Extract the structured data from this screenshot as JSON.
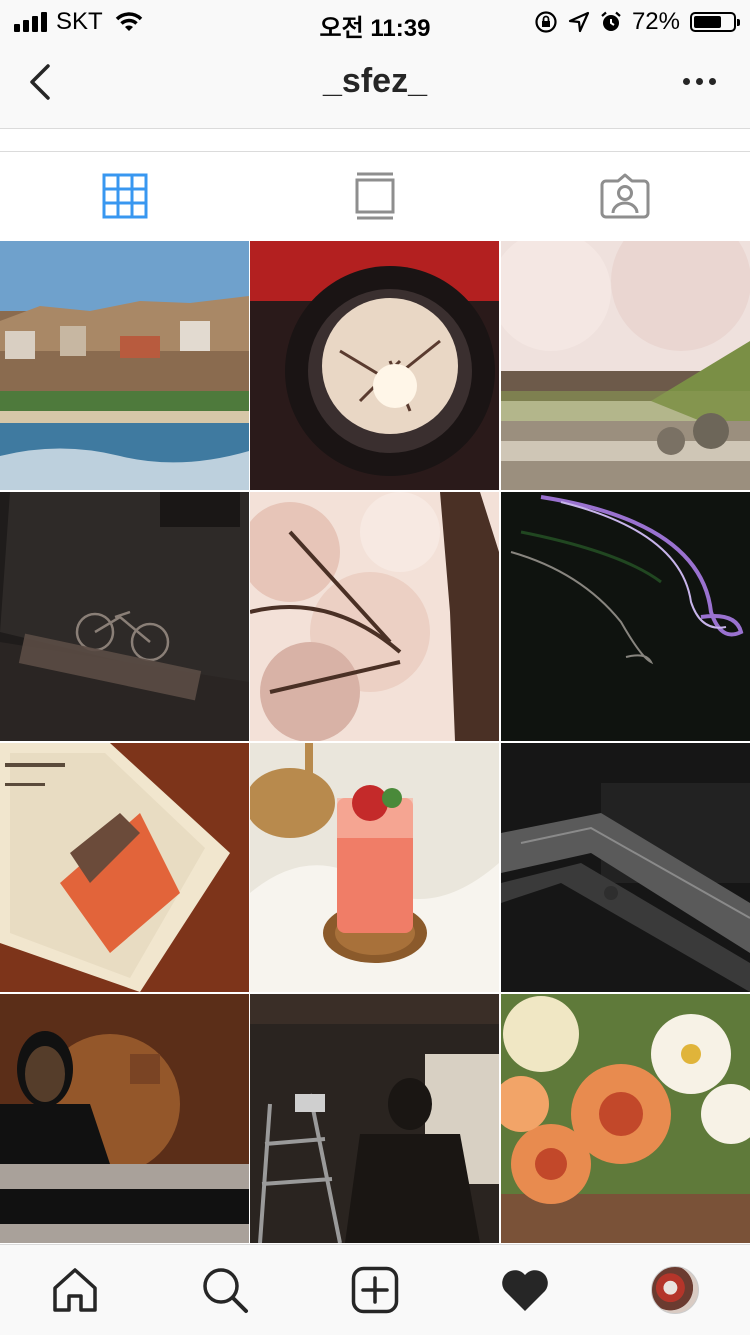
{
  "status_bar": {
    "carrier": "SKT",
    "time": "오전 11:39",
    "battery_text": "72%",
    "battery_level": 0.72,
    "icons": [
      "signal-icon",
      "wifi-icon",
      "rotation-lock-icon",
      "location-icon",
      "alarm-icon",
      "battery-icon"
    ]
  },
  "header": {
    "title": "_sfez_",
    "back_icon": "chevron-left-icon",
    "more_icon": "more-horizontal-icon"
  },
  "tabs": [
    {
      "name": "grid-view",
      "icon": "grid-icon",
      "active": true,
      "color": "#3897f0"
    },
    {
      "name": "feed-view",
      "icon": "feed-icon",
      "active": false
    },
    {
      "name": "tagged-view",
      "icon": "tagged-person-icon",
      "active": false
    }
  ],
  "posts": [
    {
      "description": "coastal town and ocean",
      "colors": [
        "#6fa1cc",
        "#8a6b4f",
        "#3f7aa0"
      ]
    },
    {
      "description": "camera lens with cherry blossom reflection",
      "colors": [
        "#2a1a1a",
        "#b32020",
        "#e9d7c5"
      ]
    },
    {
      "description": "cherry blossoms by stream",
      "colors": [
        "#efe1dd",
        "#7a8f45",
        "#9b8f7e"
      ]
    },
    {
      "description": "Portland magazine with bicycle",
      "colors": [
        "#2e2a28",
        "#1f1c1b",
        "#5b4d45"
      ]
    },
    {
      "description": "cherry blossom branches",
      "colors": [
        "#f3e1d8",
        "#4a3025",
        "#d8b2a6"
      ]
    },
    {
      "description": "light trails at night",
      "colors": [
        "#0f130f",
        "#9a72d0",
        "#2d6a2d"
      ]
    },
    {
      "description": "Campus book on wooden table",
      "colors": [
        "#8a3b1e",
        "#f1e6ce",
        "#e2643a"
      ]
    },
    {
      "description": "strawberry drink on rattan coaster",
      "colors": [
        "#eae6dc",
        "#f07d67",
        "#b88a4d"
      ]
    },
    {
      "description": "dark escalator",
      "colors": [
        "#161616",
        "#3a3a3a",
        "#5a5a5a"
      ]
    },
    {
      "description": "Kandinsky poster",
      "colors": [
        "#5b2e18",
        "#c27a3b",
        "#111111"
      ]
    },
    {
      "description": "silhouette with ladder and projector",
      "colors": [
        "#2a2420",
        "#d8d0c3",
        "#4d4138"
      ]
    },
    {
      "description": "orange roses and daisies",
      "colors": [
        "#e88b4f",
        "#f7f2e6",
        "#5f7a3a"
      ]
    }
  ],
  "bottom_nav": [
    {
      "name": "home",
      "icon": "home-icon"
    },
    {
      "name": "search",
      "icon": "search-icon"
    },
    {
      "name": "new-post",
      "icon": "add-post-icon"
    },
    {
      "name": "activity",
      "icon": "heart-icon"
    },
    {
      "name": "profile",
      "icon": "profile-avatar-icon"
    }
  ]
}
